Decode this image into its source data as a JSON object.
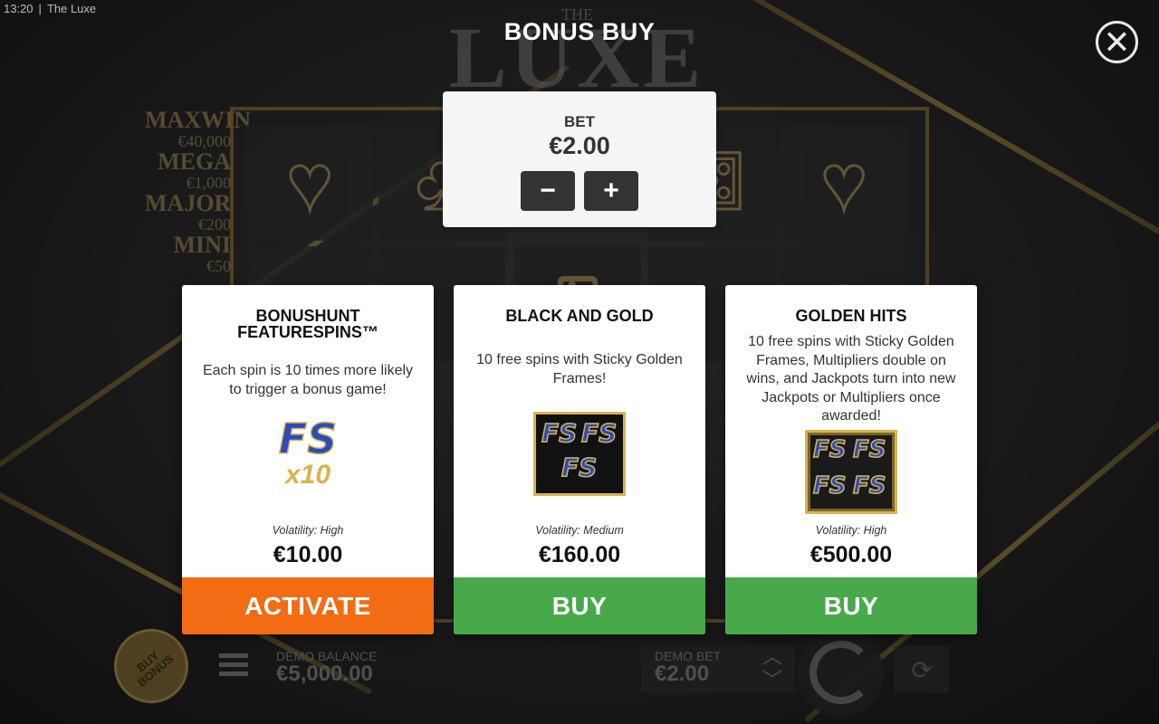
{
  "status_bar": {
    "time": "13:20",
    "app_name": "The Luxe"
  },
  "background": {
    "logo_small": "THE",
    "logo_large": "LUXE",
    "jackpots": [
      {
        "name": "MAXWIN",
        "value": "€40,000"
      },
      {
        "name": "MEGA",
        "value": "€1,000"
      },
      {
        "name": "MAJOR",
        "value": "€200"
      },
      {
        "name": "MINI",
        "value": "€50"
      }
    ]
  },
  "modal": {
    "title": "BONUS BUY",
    "close_icon": "close-icon",
    "bet": {
      "label": "BET",
      "value": "€2.00",
      "decrease_label": "−",
      "increase_label": "+"
    },
    "cards": [
      {
        "title_line1": "BONUSHUNT",
        "title_line2": "FEATURESPINS™",
        "description": "Each spin is 10 times more likely to trigger a bonus game!",
        "image": "fs-x10-icon",
        "image_text": "FS",
        "image_multiplier": "x10",
        "volatility": "Volatility: High",
        "price": "€10.00",
        "action": "ACTIVATE",
        "action_color": "#f36b12"
      },
      {
        "title_line1": "BLACK AND GOLD",
        "description": "10 free spins with Sticky Golden Frames!",
        "image": "fs-triple-icon",
        "image_text": "FS",
        "volatility": "Volatility: Medium",
        "price": "€160.00",
        "action": "BUY",
        "action_color": "#48a94a"
      },
      {
        "title_line1": "GOLDEN HITS",
        "description": "10 free spins with Sticky Golden Frames, Multipliers double on wins, and Jackpots turn into new Jackpots or Multipliers once awarded!",
        "image": "fs-quad-icon",
        "image_text": "FS",
        "volatility": "Volatility: High",
        "price": "€500.00",
        "action": "BUY",
        "action_color": "#48a94a"
      }
    ]
  },
  "bottom_bar": {
    "buy_bonus_line1": "BUY",
    "buy_bonus_line2": "BONUS",
    "balance_label": "DEMO BALANCE",
    "balance_value": "€5,000.00",
    "bet_label": "DEMO BET",
    "bet_value": "€2.00",
    "icons": [
      "menu-icon",
      "chevron-up-icon",
      "chevron-down-icon",
      "spin-icon",
      "autoplay-icon"
    ]
  },
  "colors": {
    "accent_gold": "#c9a74e",
    "activate": "#f36b12",
    "buy": "#48a94a",
    "close": "#e9e9e9"
  }
}
